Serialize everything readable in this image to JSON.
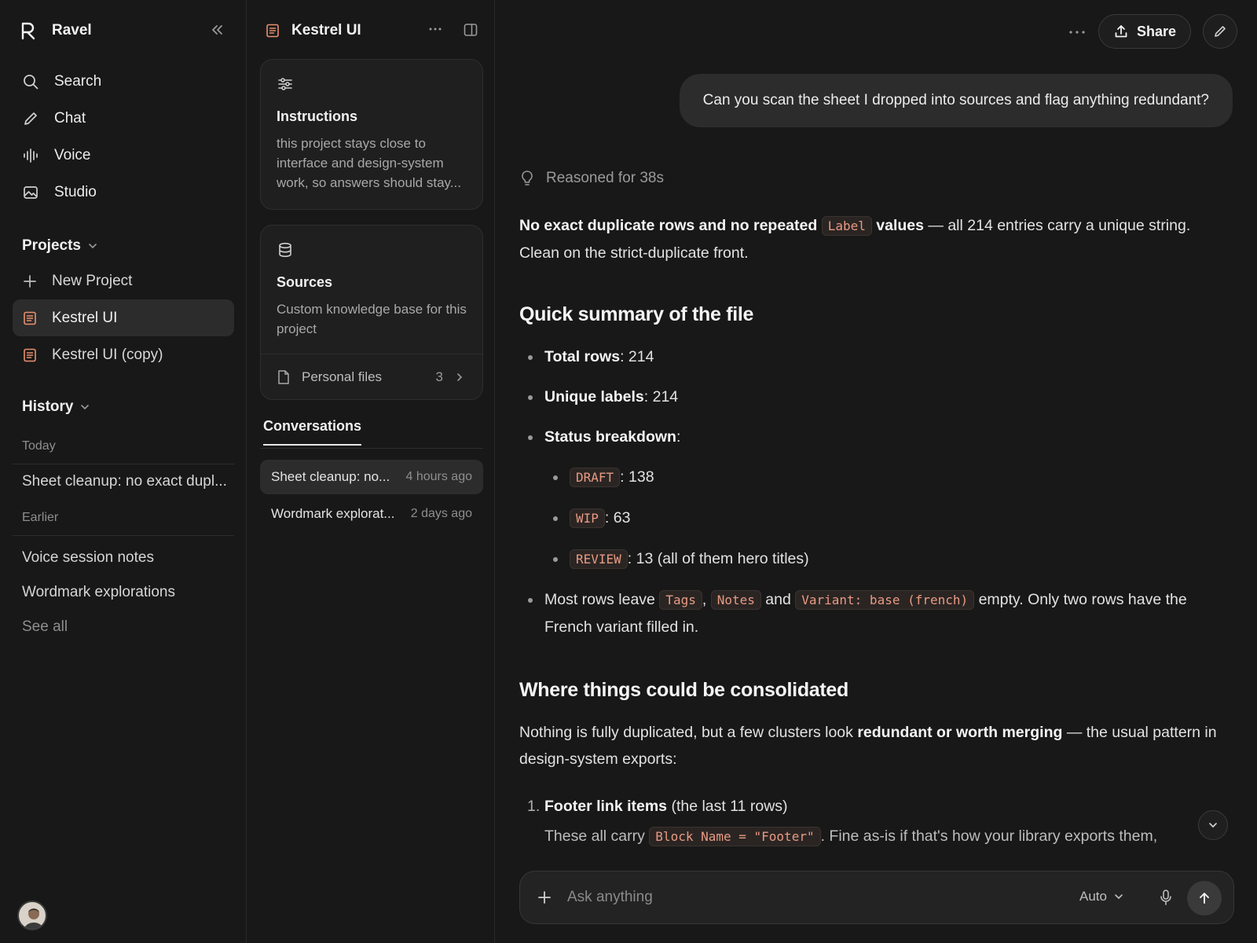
{
  "sidebar": {
    "brand": "Ravel",
    "nav": [
      {
        "label": "Search",
        "icon": "search-icon"
      },
      {
        "label": "Chat",
        "icon": "pencil-icon"
      },
      {
        "label": "Voice",
        "icon": "waveform-icon"
      },
      {
        "label": "Studio",
        "icon": "image-icon"
      }
    ],
    "projects_heading": "Projects",
    "new_project": "New Project",
    "projects": [
      {
        "label": "Kestrel UI",
        "active": true
      },
      {
        "label": "Kestrel UI (copy)",
        "active": false
      }
    ],
    "history_heading": "History",
    "today_label": "Today",
    "today_items": [
      "Sheet cleanup: no exact dupl..."
    ],
    "earlier_label": "Earlier",
    "earlier_items": [
      "Voice session notes",
      "Wordmark explorations"
    ],
    "see_all": "See all"
  },
  "panel": {
    "title": "Kestrel UI",
    "instructions": {
      "title": "Instructions",
      "text": "this project stays close to interface and design-system work, so answers should stay..."
    },
    "sources": {
      "title": "Sources",
      "text": "Custom knowledge base for this project",
      "files_label": "Personal files",
      "files_count": "3"
    },
    "conversations_tab": "Conversations",
    "conversations": [
      {
        "title": "Sheet cleanup: no...",
        "age": "4 hours ago"
      },
      {
        "title": "Wordmark explorat...",
        "age": "2 days ago"
      }
    ]
  },
  "main": {
    "share_label": "Share",
    "user_message": "Can you scan the sheet I dropped into sources and flag anything redundant?",
    "reasoned": "Reasoned for 38s",
    "p1_bold_a": "No exact duplicate rows and no repeated",
    "p1_code": "Label",
    "p1_bold_b": "values",
    "p1_rest": " — all 214 entries carry a unique string. Clean on the strict-duplicate front.",
    "h_summary": "Quick summary of the file",
    "total_rows_label": "Total rows",
    "total_rows_value": ": 214",
    "unique_labels_label": "Unique labels",
    "unique_labels_value": ": 214",
    "status_label": "Status breakdown",
    "status_colon": ":",
    "statuses": [
      {
        "code": "DRAFT",
        "value": ": 138"
      },
      {
        "code": "WIP",
        "value": ": 63"
      },
      {
        "code": "REVIEW",
        "value": ": 13 (all of them hero titles)"
      }
    ],
    "rows_text_a": "Most rows leave ",
    "rows_code_1": "Tags",
    "rows_comma": ", ",
    "rows_code_2": "Notes",
    "rows_and": " and ",
    "rows_code_3": "Variant: base (french)",
    "rows_text_b": " empty. Only two rows have the French variant filled in.",
    "h_consolidate": "Where things could be consolidated",
    "p2_a": "Nothing is fully duplicated, but a few clusters look ",
    "p2_bold": "redundant or worth merging",
    "p2_b": " — the usual pattern in design-system exports:",
    "item1_num": "1.",
    "item1_bold": "Footer link items",
    "item1_rest": " (the last 11 rows)",
    "item1_line_a": "These all carry ",
    "item1_code": "Block Name = \"Footer\"",
    "item1_line_b": ". Fine as-is if that's how your library exports them,",
    "composer_placeholder": "Ask anything",
    "mode": "Auto"
  }
}
